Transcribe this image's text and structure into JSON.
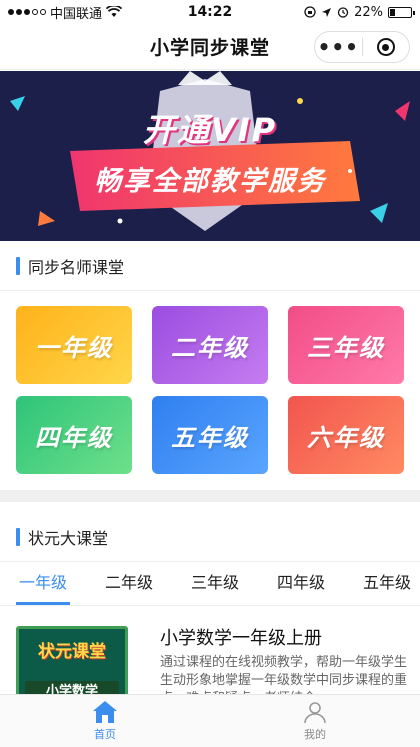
{
  "status_bar": {
    "carrier": "中国联通",
    "time": "14:22",
    "battery": "22%",
    "battery_level": 0.22
  },
  "nav": {
    "title": "小学同步课堂",
    "more_label": "•••"
  },
  "banner": {
    "line1": "开通VIP",
    "line2": "畅享全部教学服务"
  },
  "section_teachers": {
    "title": "同步名师课堂"
  },
  "grades": [
    {
      "label": "一年级",
      "color_from": "#ffb21a",
      "color_to": "#ffd64a"
    },
    {
      "label": "二年级",
      "color_from": "#9b4de0",
      "color_to": "#c57cf0"
    },
    {
      "label": "三年级",
      "color_from": "#f24d86",
      "color_to": "#ff7aa8"
    },
    {
      "label": "四年级",
      "color_from": "#2ec47a",
      "color_to": "#6ee08a"
    },
    {
      "label": "五年级",
      "color_from": "#2f7ff0",
      "color_to": "#5aa5ff"
    },
    {
      "label": "六年级",
      "color_from": "#f2554e",
      "color_to": "#ff8a62"
    }
  ],
  "section_champion": {
    "title": "状元大课堂"
  },
  "tabs": [
    "一年级",
    "二年级",
    "三年级",
    "四年级",
    "五年级"
  ],
  "course": {
    "thumb_title": "状元课堂",
    "thumb_subtitle": "小学数学",
    "title": "小学数学一年级上册",
    "description": "通过课程的在线视频教学，帮助一年级学生生动形象地掌握一年级数学中同步课程的重点、难点和疑点，老师结合"
  },
  "tabbar": {
    "home": "首页",
    "mine": "我的"
  },
  "colors": {
    "accent": "#3b8ef0",
    "banner_bg": "#1b1f4a"
  }
}
